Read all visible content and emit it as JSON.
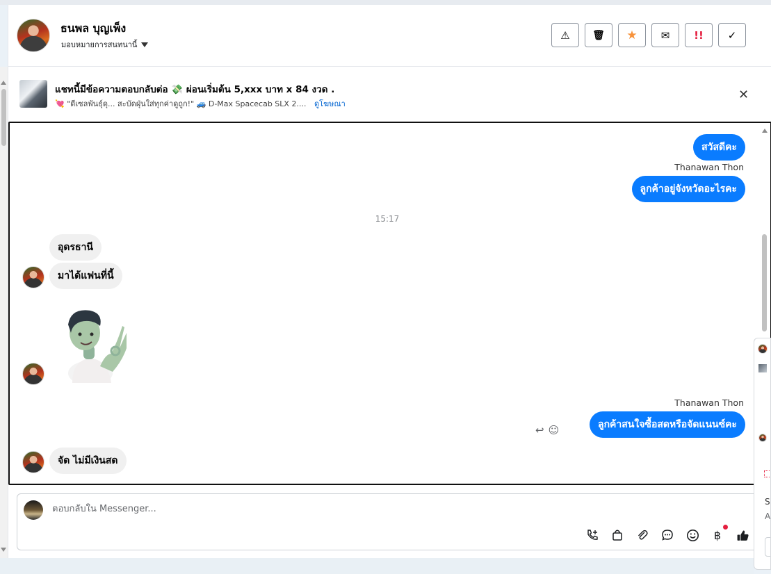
{
  "header": {
    "contact_name": "ธนพล บุญเพ็ง",
    "assign_label": "มอบหมายการสนทนานี้",
    "actions": [
      {
        "icon": "warning-icon",
        "glyph": "⚠"
      },
      {
        "icon": "trash-icon",
        "glyph": "🗑"
      },
      {
        "icon": "star-icon",
        "glyph": "★",
        "color": "#f7923b"
      },
      {
        "icon": "envelope-open-icon",
        "glyph": "✉"
      },
      {
        "icon": "urgent-icon",
        "glyph": "!!",
        "color": "#e41e3f"
      },
      {
        "icon": "check-icon",
        "glyph": "✓"
      }
    ]
  },
  "ad": {
    "title": "แชทนี้มีข้อความตอบกลับต่อ 💸 ผ่อนเริ่มต้น 5,xxx บาท x 84 งวด .",
    "subtitle": "💘 \"ดีเซลพันธุ์ดุ... สะบัดฝุ่นใส่ทุกค่าดูถูก!\" 🚙 D-Max Spacecab SLX 2....",
    "link": "ดูโฆษณา",
    "close_glyph": "✕"
  },
  "messages": {
    "out1": "สวัสดีคะ",
    "sender1": "Thanawan Thon",
    "out2": "ลูกค้าอยู่จังหวัดอะไรคะ",
    "timestamp": "15:17",
    "in1": "อุดรธานี",
    "in2": "มาได้แฟนที่นี้",
    "sender2": "Thanawan Thon",
    "out3": "ลูกค้าสนใจซื้อสดหรือจัดแนนซ์คะ",
    "in3": "จัด  ไม่มีเงินสด"
  },
  "composer": {
    "placeholder": "ตอบกลับใน Messenger...",
    "tools": [
      "phone-plus-icon",
      "shopping-bag-icon",
      "paperclip-icon",
      "chat-bubble-icon",
      "emoji-icon",
      "baht-icon",
      "thumbs-up-icon"
    ]
  },
  "side_panel": {
    "line1": "Se",
    "line2": "A"
  },
  "colors": {
    "outgoing_bubble": "#0a7cff",
    "incoming_bubble": "#f0f0f0",
    "link": "#0064d1"
  }
}
